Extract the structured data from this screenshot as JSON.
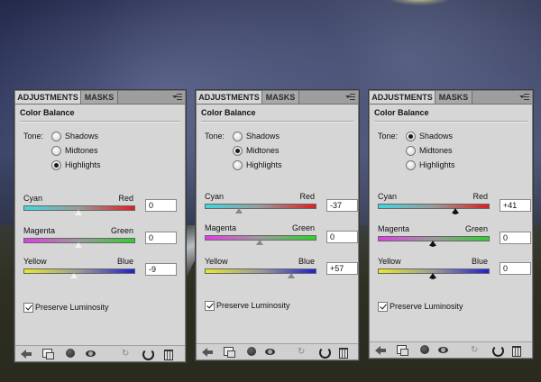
{
  "panels": [
    {
      "tabs": [
        "ADJUSTMENTS",
        "MASKS"
      ],
      "title": "Color Balance",
      "tone_label": "Tone:",
      "tone_options": [
        "Shadows",
        "Midtones",
        "Highlights"
      ],
      "tone_selected": "Highlights",
      "sliders": [
        {
          "left": "Cyan",
          "right": "Red",
          "value": "0",
          "level": 0
        },
        {
          "left": "Magenta",
          "right": "Green",
          "value": "0",
          "level": 0
        },
        {
          "left": "Yellow",
          "right": "Blue",
          "value": "-9",
          "level": -9
        }
      ],
      "preserve_label": "Preserve Luminosity",
      "preserve_checked": true
    },
    {
      "tabs": [
        "ADJUSTMENTS",
        "MASKS"
      ],
      "title": "Color Balance",
      "tone_label": "Tone:",
      "tone_options": [
        "Shadows",
        "Midtones",
        "Highlights"
      ],
      "tone_selected": "Midtones",
      "sliders": [
        {
          "left": "Cyan",
          "right": "Red",
          "value": "-37",
          "level": -37
        },
        {
          "left": "Magenta",
          "right": "Green",
          "value": "0",
          "level": 0
        },
        {
          "left": "Yellow",
          "right": "Blue",
          "value": "+57",
          "level": 57
        }
      ],
      "preserve_label": "Preserve Luminosity",
      "preserve_checked": true
    },
    {
      "tabs": [
        "ADJUSTMENTS",
        "MASKS"
      ],
      "title": "Color Balance",
      "tone_label": "Tone:",
      "tone_options": [
        "Shadows",
        "Midtones",
        "Highlights"
      ],
      "tone_selected": "Shadows",
      "sliders": [
        {
          "left": "Cyan",
          "right": "Red",
          "value": "+41",
          "level": 41
        },
        {
          "left": "Magenta",
          "right": "Green",
          "value": "0",
          "level": 0
        },
        {
          "left": "Yellow",
          "right": "Blue",
          "value": "0",
          "level": 0
        }
      ],
      "preserve_label": "Preserve Luminosity",
      "preserve_checked": true
    }
  ],
  "slider_gradients": {
    "cyan_red": [
      "#3fd7e0",
      "#e01e1e"
    ],
    "magenta_green": [
      "#e23ce6",
      "#2bd12b"
    ],
    "yellow_blue": [
      "#e9e92a",
      "#2020d0"
    ]
  },
  "bottom_icons": [
    "back-arrow-icon",
    "clip-layer-icon",
    "view-previous-icon",
    "eye-visibility-icon",
    "toggle-preview-icon",
    "reset-icon",
    "trash-icon"
  ]
}
